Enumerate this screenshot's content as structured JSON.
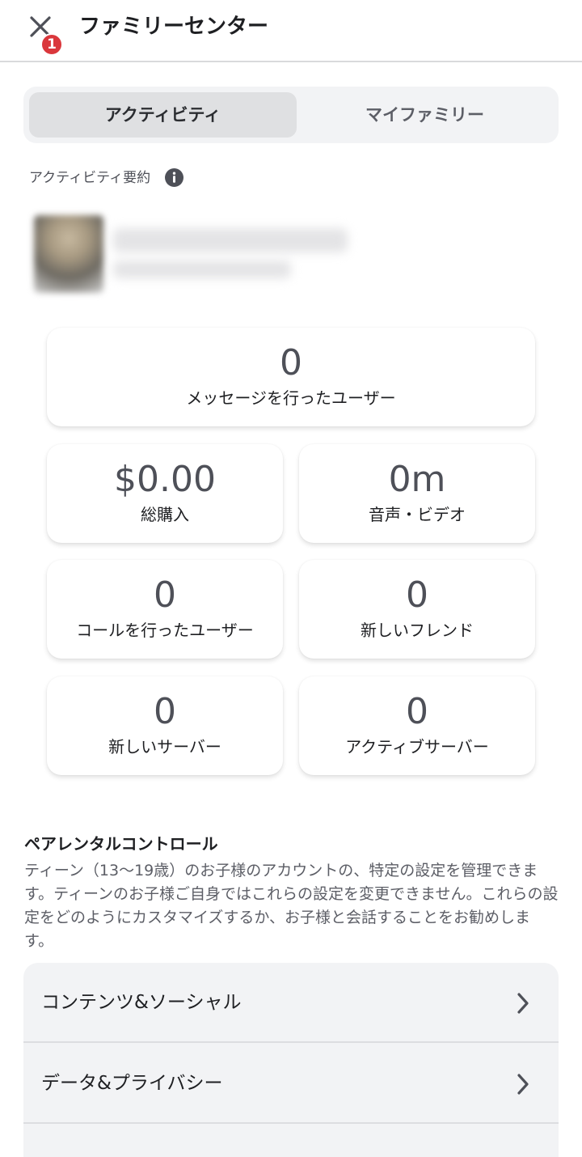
{
  "header": {
    "title": "ファミリーセンター",
    "notification_count": "1"
  },
  "tabs": [
    {
      "label": "アクティビティ",
      "active": true
    },
    {
      "label": "マイファミリー",
      "active": false
    }
  ],
  "summary": {
    "label": "アクティビティ要約"
  },
  "stats": {
    "messaged_users": {
      "value": "0",
      "label": "メッセージを行ったユーザー"
    },
    "total_purchases": {
      "value": "$0.00",
      "label": "総購入"
    },
    "voice_video": {
      "value": "0m",
      "label": "音声・ビデオ"
    },
    "called_users": {
      "value": "0",
      "label": "コールを行ったユーザー"
    },
    "new_friends": {
      "value": "0",
      "label": "新しいフレンド"
    },
    "new_servers": {
      "value": "0",
      "label": "新しいサーバー"
    },
    "active_servers": {
      "value": "0",
      "label": "アクティブサーバー"
    }
  },
  "parental": {
    "title": "ペアレンタルコントロール",
    "description": "ティーン（13〜19歳）のお子様のアカウントの、特定の設定を管理できます。ティーンのお子様ご自身ではこれらの設定を変更できません。これらの設定をどのようにカスタマイズするか、お子様と会話することをお勧めします。",
    "items": [
      {
        "label": "コンテンツ&ソーシャル"
      },
      {
        "label": "データ&プライバシー"
      }
    ]
  },
  "colors": {
    "badge": "#da373c",
    "tab_bg": "#f2f3f5",
    "tab_active": "#dfe0e2"
  }
}
